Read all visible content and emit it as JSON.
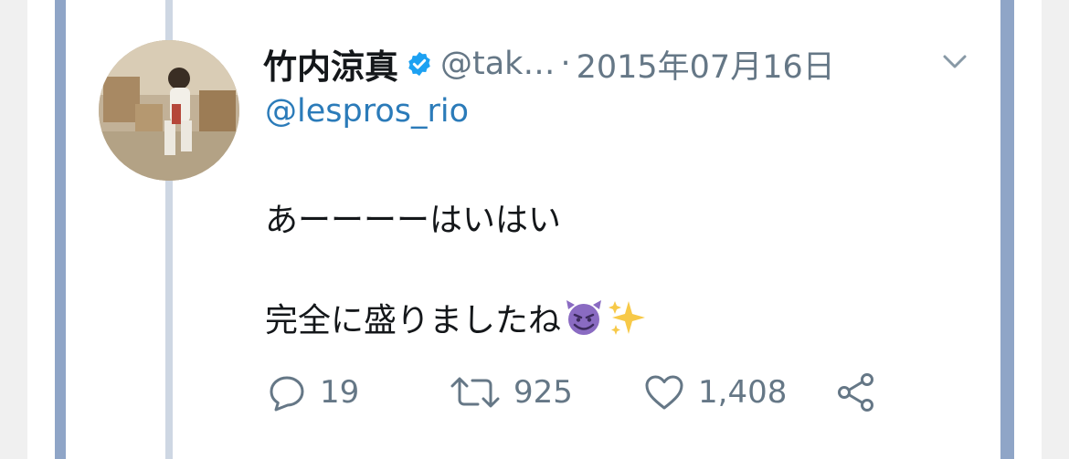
{
  "tweet": {
    "display_name": "竹内涼真",
    "handle": "@tak…",
    "separator": "·",
    "date": "2015年07月16日",
    "reply_to": "@lespros_rio",
    "text_line1": "あーーーーはいはい",
    "text_line2": "完全に盛りましたね",
    "emojis": [
      "smiling-devil-icon",
      "sparkles-icon"
    ],
    "stats": {
      "replies": "19",
      "retweets": "925",
      "likes": "1,408"
    }
  },
  "icons": {
    "verified": "verified-badge-icon",
    "menu": "chevron-down-icon",
    "reply": "reply-icon",
    "retweet": "retweet-icon",
    "like": "heart-icon",
    "share": "share-icon"
  },
  "colors": {
    "link": "#2b7bb9",
    "verified": "#1da1f2",
    "muted": "#657786",
    "frame": "#8fa5c7",
    "thread_line": "#ced7e3"
  }
}
